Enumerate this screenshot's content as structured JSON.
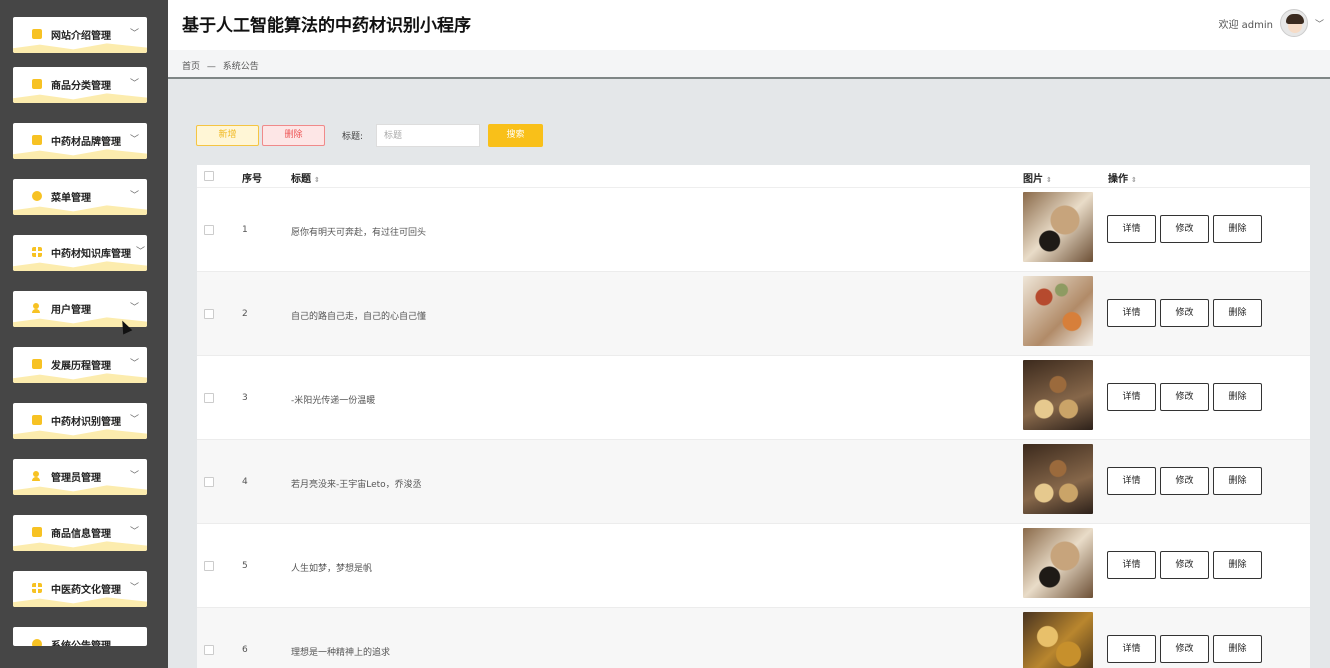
{
  "app": {
    "title": "基于人工智能算法的中药材识别小程序",
    "welcome": "欢迎 admin"
  },
  "breadcrumb": {
    "home": "首页",
    "separator": "—",
    "current": "系统公告"
  },
  "sidebar": {
    "items": [
      {
        "label": "网站介绍管理",
        "icon": "monitor-icon"
      },
      {
        "label": "商品分类管理",
        "icon": "folder-icon"
      },
      {
        "label": "中药材品牌管理",
        "icon": "tag-icon"
      },
      {
        "label": "菜单管理",
        "icon": "circle-icon"
      },
      {
        "label": "中药材知识库管理",
        "icon": "book-icon"
      },
      {
        "label": "用户管理",
        "icon": "user-icon"
      },
      {
        "label": "发展历程管理",
        "icon": "folder-icon"
      },
      {
        "label": "中药材识别管理",
        "icon": "card-icon"
      },
      {
        "label": "管理员管理",
        "icon": "user-icon"
      },
      {
        "label": "商品信息管理",
        "icon": "folder-icon"
      },
      {
        "label": "中医药文化管理",
        "icon": "grid-icon"
      },
      {
        "label": "系统公告管理",
        "icon": "circle-icon"
      }
    ]
  },
  "toolbar": {
    "add_label": "新增",
    "delete_label": "删除",
    "search_label": "标题:",
    "search_placeholder": "标题",
    "search_button": "搜索"
  },
  "table": {
    "headers": {
      "index": "序号",
      "title": "标题",
      "image": "图片",
      "actions": "操作"
    },
    "actions": {
      "detail": "详情",
      "edit": "修改",
      "delete": "删除"
    },
    "rows": [
      {
        "index": "1",
        "title": "愿你有明天可奔赴，有过往可回头"
      },
      {
        "index": "2",
        "title": "自己的路自己走，自己的心自己懂"
      },
      {
        "index": "3",
        "title": "-米阳光传递一份温暖"
      },
      {
        "index": "4",
        "title": "若月亮没来-王宇宙Leto，乔浚丞"
      },
      {
        "index": "5",
        "title": "人生如梦，梦想是帆"
      },
      {
        "index": "6",
        "title": "理想是一种精神上的追求"
      }
    ]
  }
}
